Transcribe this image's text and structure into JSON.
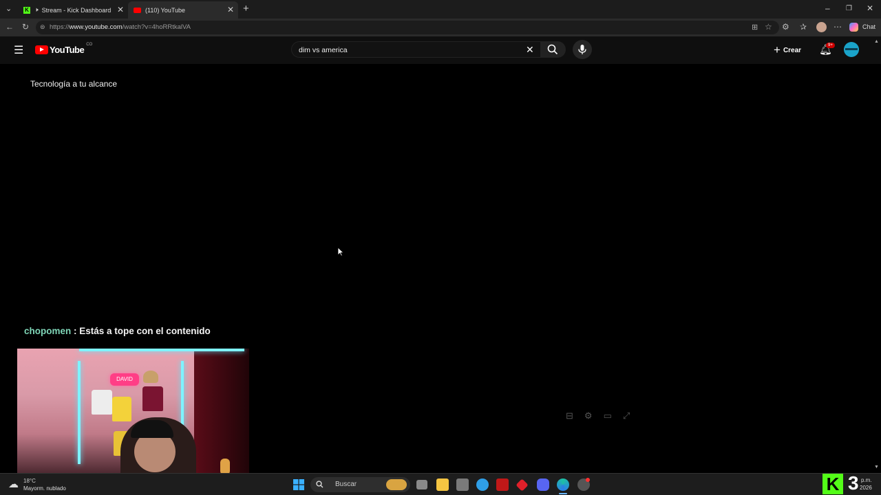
{
  "browser": {
    "tabs": [
      {
        "title": "Stream - Kick Dashboard",
        "active": false
      },
      {
        "title": "(110) YouTube",
        "active": true
      }
    ],
    "url_prefix": "https://",
    "url_domain": "www.youtube.com",
    "url_path": "/watch?v=4hoRRtkalVA",
    "copilot_label": "Chat"
  },
  "youtube": {
    "logo_text": "YouTube",
    "region": "CO",
    "search_query": "dim vs america",
    "create_label": "Crear",
    "notification_badge": "9+",
    "channel_text": "Tecnología a tu alcance"
  },
  "overlay": {
    "chat_user": "chopomen",
    "chat_message": " : Estás a tope con el contenido",
    "neon_sign": "DAVID"
  },
  "taskbar": {
    "weather_temp": "18°C",
    "weather_desc": "Mayorm. nublado",
    "search_label": "Buscar",
    "clock_time": "p.m.",
    "clock_date": "2026",
    "kick_number": "3"
  },
  "colors": {
    "chat_user": "#7fd6b8",
    "kick_green": "#53fc18",
    "yt_red": "#ff0000",
    "accent_cyan": "#5be8ff"
  }
}
